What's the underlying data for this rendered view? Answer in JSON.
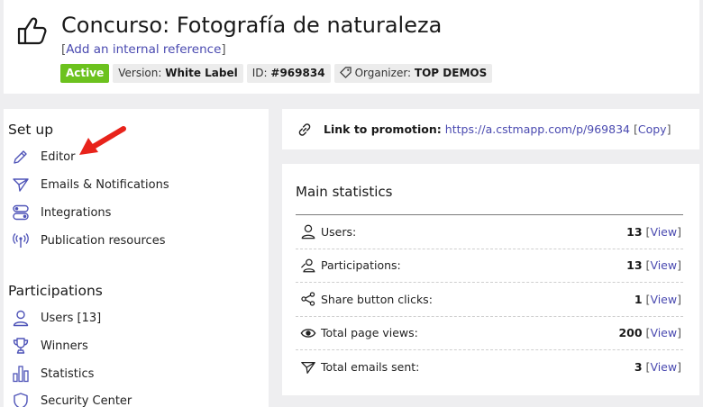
{
  "header": {
    "title": "Concurso: Fotografía de naturaleza",
    "add_reference": "Add an internal reference",
    "tags": {
      "status": "Active",
      "version_label": "Version:",
      "version_value": "White Label",
      "id_label": "ID:",
      "id_value": "#969834",
      "organizer_label": "Organizer:",
      "organizer_value": "TOP DEMOS"
    }
  },
  "sidebar": {
    "setup_title": "Set up",
    "setup_items": [
      {
        "label": "Editor",
        "icon": "pencil-icon"
      },
      {
        "label": "Emails & Notifications",
        "icon": "paper-plane-icon"
      },
      {
        "label": "Integrations",
        "icon": "toggles-icon"
      },
      {
        "label": "Publication resources",
        "icon": "broadcast-icon"
      }
    ],
    "participations_title": "Participations",
    "participation_items": [
      {
        "label": "Users [13]",
        "icon": "user-icon"
      },
      {
        "label": "Winners",
        "icon": "trophy-icon"
      },
      {
        "label": "Statistics",
        "icon": "bar-chart-icon"
      },
      {
        "label": "Security Center",
        "icon": "shield-icon"
      }
    ]
  },
  "promotion": {
    "label": "Link to promotion:",
    "url": "https://a.cstmapp.com/p/969834",
    "copy_label": "Copy"
  },
  "stats": {
    "title": "Main statistics",
    "view_label": "View",
    "rows": [
      {
        "label": "Users:",
        "value": "13",
        "icon": "user-icon"
      },
      {
        "label": "Participations:",
        "value": "13",
        "icon": "participation-icon"
      },
      {
        "label": "Share button clicks:",
        "value": "1",
        "icon": "share-icon"
      },
      {
        "label": "Total page views:",
        "value": "200",
        "icon": "eye-icon"
      },
      {
        "label": "Total emails sent:",
        "value": "3",
        "icon": "paper-plane-icon"
      }
    ]
  },
  "colors": {
    "accent": "#4a4ab0",
    "active_badge": "#6cc21e",
    "annotation_arrow": "#e8231b",
    "icon_stroke": "#4f54b8"
  }
}
